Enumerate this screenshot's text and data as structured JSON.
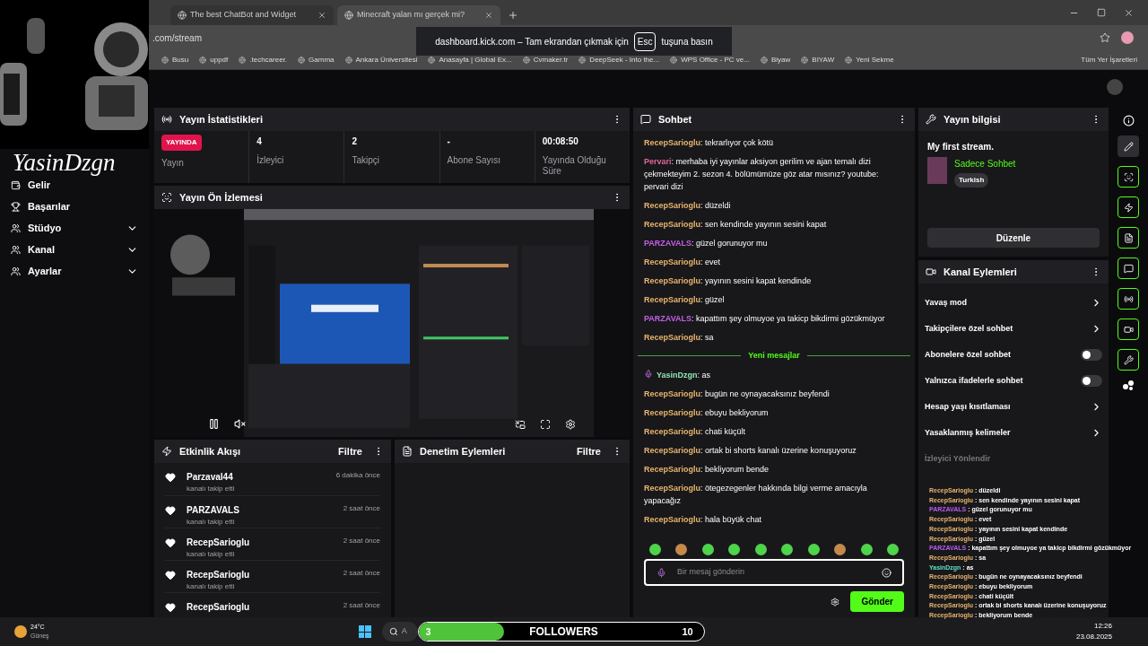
{
  "browser": {
    "tabs": [
      {
        "title": "The best ChatBot and Widget",
        "selected": false
      },
      {
        "title": "Minecraft yalan mı gerçek mi?",
        "selected": true
      }
    ],
    "address": ".com/stream",
    "bookmarks": [
      "Busu",
      "uppdf",
      ".techcareer.",
      "Gamma",
      "Ankara Üniversitesi",
      "Anasayfa | Global Ex...",
      "Cvmaker.tr",
      "DeepSeek - Into the...",
      "WPS Office - PC ve...",
      "Biyaw",
      "BIYAW",
      "Yeni Sekme"
    ],
    "all_bookmarks": "Tüm Yer İşaretleri",
    "fullscreen_notice": {
      "before": "dashboard.kick.com – Tam ekrandan çıkmak için",
      "key": "Esc",
      "after": "tuşuna basın"
    }
  },
  "overlay_name": "YasinDzgn",
  "sidebar": [
    {
      "label": "Gelir",
      "kind": "plain"
    },
    {
      "label": "Başarılar",
      "kind": "plain"
    },
    {
      "label": "Stüdyo",
      "kind": "group"
    },
    {
      "label": "Kanal",
      "kind": "group"
    },
    {
      "label": "Ayarlar",
      "kind": "group"
    }
  ],
  "stats": {
    "title": "Yayın İstatistikleri",
    "live_badge": "YAYINDA",
    "items": [
      {
        "value": "",
        "label": "Yayın",
        "kind": "live"
      },
      {
        "value": "4",
        "label": "İzleyici",
        "kind": "number"
      },
      {
        "value": "2",
        "label": "Takipçi",
        "kind": "number"
      },
      {
        "value": "-",
        "label": "Abone Sayısı",
        "kind": "number"
      },
      {
        "value": "00:08:50",
        "label": "Yayında Olduğu Süre",
        "kind": "number"
      }
    ]
  },
  "preview": {
    "title": "Yayın Ön İzlemesi",
    "paused": false,
    "muted": true
  },
  "activity": {
    "title": "Etkinlik Akışı",
    "filter": "Filtre",
    "events": [
      {
        "user": "Parzaval44",
        "action": "kanalı takip etti",
        "time": "6 dakika önce"
      },
      {
        "user": "PARZAVALS",
        "action": "kanalı takip etti",
        "time": "2 saat önce"
      },
      {
        "user": "RecepSarioglu",
        "action": "kanalı takip etti",
        "time": "2 saat önce"
      },
      {
        "user": "RecepSarioglu",
        "action": "kanalı takip etti",
        "time": "2 saat önce"
      },
      {
        "user": "RecepSarioglu",
        "time": "2 saat önce"
      }
    ]
  },
  "moderation": {
    "title": "Denetim Eylemleri",
    "filter": "Filtre"
  },
  "chat": {
    "title": "Sohbet",
    "new_divider": "Yeni mesajlar",
    "separator": ":",
    "messages": [
      {
        "user": "RecepSarioglu",
        "color": "#e8b46c",
        "text": "tekrarlıyor çok kötü",
        "kind": "old"
      },
      {
        "user": "Pervari",
        "color": "#e0669a",
        "text": "merhaba iyi yayınlar aksiyon gerilim ve ajan temalı dizi çekmekteyim 2. sezon 4. bölümümüze göz atar mısınız? youtube: pervari dizi",
        "kind": "old"
      },
      {
        "user": "RecepSarioglu",
        "color": "#e8b46c",
        "text": "düzeldi",
        "kind": "old"
      },
      {
        "user": "RecepSarioglu",
        "color": "#e8b46c",
        "text": "sen kendinde yayının sesini kapat",
        "kind": "old"
      },
      {
        "user": "PARZAVALS",
        "color": "#c45fe6",
        "text": "güzel gorunuyor mu",
        "kind": "old"
      },
      {
        "user": "RecepSarioglu",
        "color": "#e8b46c",
        "text": "evet",
        "kind": "old"
      },
      {
        "user": "RecepSarioglu",
        "color": "#e8b46c",
        "text": "yayının sesini kapat kendinde",
        "kind": "old"
      },
      {
        "user": "RecepSarioglu",
        "color": "#e8b46c",
        "text": "güzel",
        "kind": "old"
      },
      {
        "user": "PARZAVALS",
        "color": "#c45fe6",
        "text": "kapattım şey olmuyoe ya takicp bikdirmi gözükmüyor",
        "kind": "old"
      },
      {
        "user": "RecepSarioglu",
        "color": "#e8b46c",
        "text": "sa",
        "kind": "old"
      },
      {
        "user": "YasinDzgn",
        "color": "#8fe3b0",
        "text": "as",
        "kind": "broadcaster"
      },
      {
        "user": "RecepSarioglu",
        "color": "#e8b46c",
        "text": "bugün ne oynayacaksınız beyfendi",
        "kind": "new"
      },
      {
        "user": "RecepSarioglu",
        "color": "#e8b46c",
        "text": "ebuyu bekliyorum",
        "kind": "new"
      },
      {
        "user": "RecepSarioglu",
        "color": "#e8b46c",
        "text": "chati küçült",
        "kind": "new"
      },
      {
        "user": "RecepSarioglu",
        "color": "#e8b46c",
        "text": "ortak bi shorts kanalı üzerine konuşuyoruz",
        "kind": "new"
      },
      {
        "user": "RecepSarioglu",
        "color": "#e8b46c",
        "text": "bekliyorum bende",
        "kind": "new"
      },
      {
        "user": "RecepSarioglu",
        "color": "#e8b46c",
        "text": "ötegezegenler hakkında bilgi verme amacıyla yapacağız",
        "kind": "new"
      },
      {
        "user": "RecepSarioglu",
        "color": "#e8b46c",
        "text": "hala büyük chat",
        "kind": "new"
      }
    ],
    "input_placeholder": "Bir mesaj gönderin",
    "send": "Gönder"
  },
  "stream_info": {
    "title": "Yayın bilgisi",
    "stream_title": "My first stream.",
    "category": "Sadece Sohbet",
    "language": "Turkish",
    "edit": "Düzenle"
  },
  "channel_actions": {
    "title": "Kanal Eylemleri",
    "items": [
      {
        "label": "Yavaş mod",
        "kind": "link",
        "disabled": false
      },
      {
        "label": "Takipçilere özel sohbet",
        "kind": "link",
        "disabled": false
      },
      {
        "label": "Abonelere özel sohbet",
        "kind": "toggle",
        "on": false,
        "disabled": false
      },
      {
        "label": "Yalnızca ifadelerle sohbet",
        "kind": "toggle",
        "on": false,
        "disabled": false
      },
      {
        "label": "Hesap yaşı kısıtlaması",
        "kind": "link",
        "disabled": false
      },
      {
        "label": "Yasaklanmış kelimeler",
        "kind": "link",
        "disabled": false
      },
      {
        "label": "İzleyici Yönlendir",
        "kind": "label",
        "disabled": true
      }
    ]
  },
  "overlay_separator": " : ",
  "overlay_chat": [
    {
      "user": "RecepSarioglu",
      "color": "#e8b46c",
      "text": "düzeldi"
    },
    {
      "user": "RecepSarioglu",
      "color": "#e8b46c",
      "text": "sen kendinde yayının sesini kapat"
    },
    {
      "user": "PARZAVALS",
      "color": "#b65cf0",
      "text": "güzel gorunuyor mu"
    },
    {
      "user": "RecepSarioglu",
      "color": "#e8b46c",
      "text": "evet"
    },
    {
      "user": "RecepSarioglu",
      "color": "#e8b46c",
      "text": "yayının sesini kapat kendinde"
    },
    {
      "user": "RecepSarioglu",
      "color": "#e8b46c",
      "text": "güzel"
    },
    {
      "user": "PARZAVALS",
      "color": "#b65cf0",
      "text": "kapattım şey olmuyoe ya takicp bikdirmi gözükmüyor"
    },
    {
      "user": "RecepSarioglu",
      "color": "#e8b46c",
      "text": "sa"
    },
    {
      "user": "YasinDzgn",
      "color": "#5fe0c0",
      "text": "as"
    },
    {
      "user": "RecepSarioglu",
      "color": "#e8b46c",
      "text": "bugün ne oynayacaksınız beyfendi"
    },
    {
      "user": "RecepSarioglu",
      "color": "#e8b46c",
      "text": "ebuyu bekliyorum"
    },
    {
      "user": "RecepSarioglu",
      "color": "#e8b46c",
      "text": "chati küçült"
    },
    {
      "user": "RecepSarioglu",
      "color": "#e8b46c",
      "text": "ortak bi shorts kanalı üzerine konuşuyoruz"
    },
    {
      "user": "RecepSarioglu",
      "color": "#e8b46c",
      "text": "bekliyorum bende"
    }
  ],
  "followers_bar": {
    "count": "3",
    "label": "FOLLOWERS",
    "goal": "10",
    "level": 0.3
  },
  "taskbar": {
    "temperature": "24°C",
    "weather": "Güneş",
    "search": "A",
    "time": "12:26",
    "date": "23.08.2025"
  }
}
